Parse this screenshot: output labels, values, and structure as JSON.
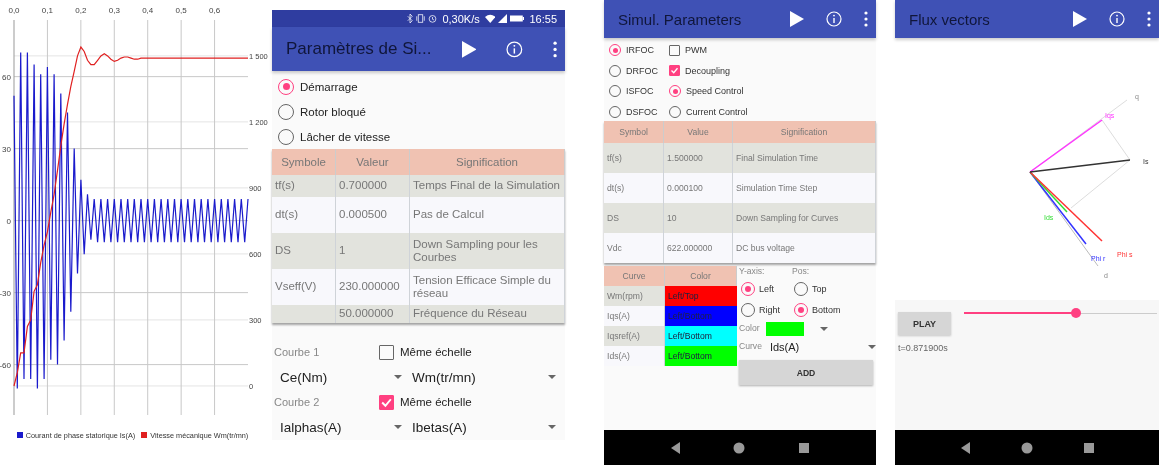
{
  "chart_panel": {
    "chart_data": {
      "type": "line",
      "x": [
        0,
        0.01,
        0.02,
        0.03,
        0.04,
        0.05,
        0.06,
        0.07,
        0.08,
        0.09,
        0.1,
        0.11,
        0.12,
        0.13,
        0.14,
        0.15,
        0.16,
        0.17,
        0.18,
        0.19,
        0.2,
        0.21,
        0.22,
        0.23,
        0.24,
        0.25,
        0.26,
        0.27,
        0.28,
        0.29,
        0.3,
        0.31,
        0.32,
        0.33,
        0.34,
        0.35,
        0.36,
        0.37,
        0.38,
        0.39,
        0.4,
        0.41,
        0.42,
        0.43,
        0.44,
        0.45,
        0.46,
        0.47,
        0.48,
        0.49,
        0.5,
        0.51,
        0.52,
        0.53,
        0.54,
        0.55,
        0.56,
        0.57,
        0.58,
        0.59,
        0.6,
        0.61,
        0.62,
        0.63,
        0.64,
        0.65,
        0.66,
        0.67,
        0.68,
        0.69,
        0.7
      ],
      "series": [
        {
          "name": "Courant de phase statorique Is(A)",
          "color": "#1a1acc",
          "values": [
            52,
            -70,
            70,
            -66,
            70,
            -66,
            65,
            -70,
            61,
            -66,
            64,
            -58,
            61,
            -60,
            53,
            -50,
            45,
            -38,
            30,
            -22,
            17,
            -14,
            11,
            -8,
            9,
            -9,
            9,
            -9,
            9,
            -9,
            9,
            -9,
            9,
            -9,
            9,
            -9,
            9,
            -9,
            9,
            -9,
            9,
            -9,
            9,
            -9,
            9,
            -9,
            9,
            -9,
            9,
            -9,
            9,
            -9,
            9,
            -9,
            9,
            -9,
            9,
            -9,
            9,
            -9,
            9,
            -9,
            9,
            -9,
            9,
            -9,
            9,
            -9,
            9,
            -9,
            9
          ]
        },
        {
          "name": "Vitesse mécanique Wm(tr/mn)",
          "color": "#e02020",
          "axis": "y2",
          "values": [
            0,
            60,
            150,
            150,
            270,
            300,
            430,
            460,
            560,
            640,
            700,
            790,
            870,
            980,
            1090,
            1190,
            1280,
            1360,
            1430,
            1500,
            1540,
            1520,
            1480,
            1460,
            1460,
            1480,
            1500,
            1510,
            1500,
            1485,
            1475,
            1480,
            1490,
            1495,
            1495,
            1490,
            1485,
            1485,
            1490,
            1490,
            1490,
            1490,
            1490,
            1490,
            1490,
            1490,
            1490,
            1490,
            1490,
            1490,
            1490,
            1490,
            1490,
            1490,
            1490,
            1490,
            1490,
            1490,
            1490,
            1490,
            1490,
            1490,
            1490,
            1490,
            1490,
            1490,
            1490,
            1490,
            1490,
            1490,
            1490
          ]
        }
      ],
      "grid": true,
      "legend": "bottom",
      "xlim": [
        0,
        0.7
      ],
      "ylim": [
        -81,
        83.6
      ],
      "y2lim": [
        -132,
        1663
      ],
      "xticks": [
        {
          "value": 0,
          "label": "0,0"
        },
        {
          "value": 0.1,
          "label": "0,1"
        },
        {
          "value": 0.2,
          "label": "0,2"
        },
        {
          "value": 0.3,
          "label": "0,3"
        },
        {
          "value": 0.4,
          "label": "0,4"
        },
        {
          "value": 0.5,
          "label": "0,5"
        },
        {
          "value": 0.6,
          "label": "0,6"
        }
      ],
      "yticks": [
        -60,
        -30,
        0,
        30,
        60
      ],
      "y2ticks": [
        {
          "value": 0,
          "label": "0"
        },
        {
          "value": 300,
          "label": "300"
        },
        {
          "value": 600,
          "label": "600"
        },
        {
          "value": 900,
          "label": "900"
        },
        {
          "value": 1200,
          "label": "1 200"
        },
        {
          "value": 1500,
          "label": "1 500"
        }
      ]
    }
  },
  "sim_screen": {
    "status_bar": {
      "network_speed": "0,30K/s",
      "time": "16:55"
    },
    "title": "Paramètres de Si...",
    "modes": [
      {
        "label": "Démarrage",
        "selected": true
      },
      {
        "label": "Rotor bloqué",
        "selected": false
      },
      {
        "label": "Lâcher de vitesse",
        "selected": false
      }
    ],
    "table": {
      "columns": [
        "Symbole",
        "Valeur",
        "Signification"
      ],
      "rows": [
        {
          "symbol": "tf(s)",
          "value": "0.700000",
          "meaning": "Temps Final de la Simulation"
        },
        {
          "symbol": "dt(s)",
          "value": "0.000500",
          "meaning": "Pas de Calcul"
        },
        {
          "symbol": "DS",
          "value": "1",
          "meaning": "Down Sampling pour les Courbes"
        },
        {
          "symbol": "Vseff(V)",
          "value": "230.000000",
          "meaning": "Tension Efficace Simple du réseau"
        },
        {
          "value": "50.000000",
          "meaning": "Fréquence du Réseau"
        }
      ]
    },
    "curves": [
      {
        "label": "Courbe 1",
        "same_scale_label": "Même échelle",
        "same_scale": false,
        "left": "Ce(Nm)",
        "right": "Wm(tr/mn)"
      },
      {
        "label": "Courbe 2",
        "same_scale_label": "Même échelle",
        "same_scale": true,
        "left": "Ialphas(A)",
        "right": "Ibetas(A)"
      }
    ]
  },
  "params_screen": {
    "title": "Simul. Parameters",
    "options": [
      {
        "kind": "radio",
        "label": "IRFOC",
        "selected": true
      },
      {
        "kind": "checkbox",
        "label": "PWM",
        "checked": false
      },
      {
        "kind": "radio",
        "label": "DRFOC",
        "selected": false
      },
      {
        "kind": "checkbox",
        "label": "Decoupling",
        "checked": true
      },
      {
        "kind": "radio",
        "label": "ISFOC",
        "selected": false
      },
      {
        "kind": "radio",
        "label": "Speed Control",
        "selected": true
      },
      {
        "kind": "radio",
        "label": "DSFOC",
        "selected": false
      },
      {
        "kind": "radio",
        "label": "Current Control",
        "selected": false
      }
    ],
    "table": {
      "columns": [
        "Symbol",
        "Value",
        "Signification"
      ],
      "rows": [
        {
          "symbol": "tf(s)",
          "value": "1.500000",
          "meaning": "Final Simulation Time"
        },
        {
          "symbol": "dt(s)",
          "value": "0.000100",
          "meaning": "Simulation Time Step"
        },
        {
          "symbol": "DS",
          "value": "10",
          "meaning": "Down Sampling for Curves"
        },
        {
          "symbol": "Vdc",
          "value": "622.000000",
          "meaning": "DC bus voltage"
        }
      ]
    },
    "curve_table": {
      "columns": [
        "Curve",
        "Color"
      ],
      "rows": [
        {
          "curve": "Wm(rpm)",
          "position": "Left/Top",
          "color": "#ff0000"
        },
        {
          "curve": "Iqs(A)",
          "position": "Left/Bottom",
          "color": "#0000ff"
        },
        {
          "curve": "Iqsref(A)",
          "position": "Left/Bottom",
          "color": "#00ffff"
        },
        {
          "curve": "Ids(A)",
          "position": "Left/Bottom",
          "color": "#00ff00"
        }
      ]
    },
    "y_axis": {
      "label": "Y-axis:",
      "options": [
        {
          "label": "Left",
          "selected": true
        },
        {
          "label": "Right",
          "selected": false
        }
      ]
    },
    "pos": {
      "label": "Pos:",
      "options": [
        {
          "label": "Top",
          "selected": false
        },
        {
          "label": "Bottom",
          "selected": true
        }
      ]
    },
    "color_picker": {
      "label": "Color",
      "color": "#00ff00"
    },
    "curve_label": "Curve",
    "curve_value": "Ids(A)",
    "add_button": "ADD"
  },
  "flux_screen": {
    "title": "Flux vectors",
    "axes": [
      {
        "label": "q"
      },
      {
        "label": "d"
      }
    ],
    "vectors": [
      {
        "label": "Iqs",
        "color": "#ff33ff"
      },
      {
        "label": "Is",
        "color": "#333333"
      },
      {
        "label": "Ids",
        "color": "#33dd33"
      },
      {
        "label": "Phi r",
        "color": "#3333ff"
      },
      {
        "label": "Phi s",
        "color": "#ff3333"
      }
    ],
    "play_button": "PLAY",
    "slider": {
      "level": 0.58
    },
    "time": "t=0.871900s"
  }
}
